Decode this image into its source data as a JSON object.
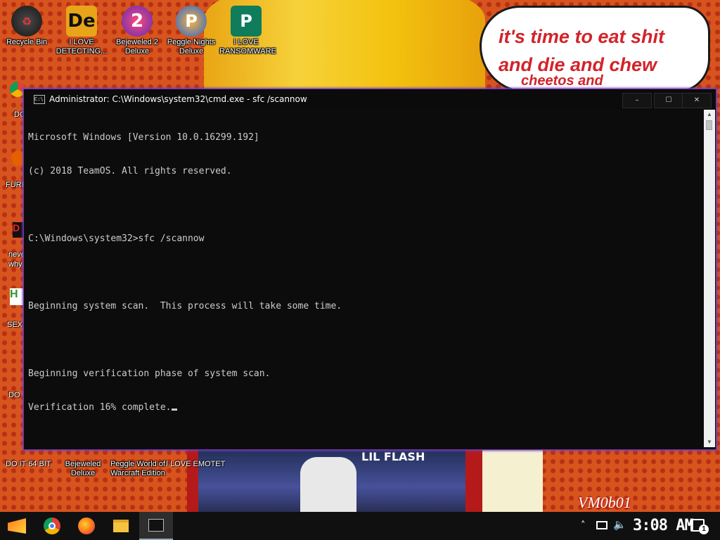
{
  "desktop": {
    "wallpaper_text": {
      "line1": "it's time to eat shit",
      "line2": "and die and chew",
      "line3": "cheetos and"
    },
    "album_text": "LIL FLASH",
    "watermark": "VM0b01",
    "top_icons": [
      {
        "label": "Recycle Bin",
        "icon": "recycle-bin-icon"
      },
      {
        "label": "I LOVE DETECTING...",
        "icon": "app-icon-de"
      },
      {
        "label": "Bejeweled 2 Deluxe",
        "icon": "bejeweled-icon"
      },
      {
        "label": "Peggle Nights Deluxe",
        "icon": "peggle-icon"
      },
      {
        "label": "I LOVE RANSOMWARE",
        "icon": "publisher-icon"
      }
    ],
    "left_partial_labels": [
      "DC",
      "FURF",
      "neve",
      "why",
      "SEX",
      "DO"
    ],
    "bottom_icons": [
      {
        "label": "DO IT 64 BIT"
      },
      {
        "label": "Bejeweled Deluxe"
      },
      {
        "label": "Peggle World of Warcraft Edition"
      },
      {
        "label": "I LOVE EMOTET"
      }
    ]
  },
  "cmd_window": {
    "title": "Administrator: C:\\Windows\\system32\\cmd.exe - sfc  /scannow",
    "buttons": {
      "minimize": "–",
      "maximize": "☐",
      "close": "✕"
    },
    "lines": [
      "Microsoft Windows [Version 10.0.16299.192]",
      "(c) 2018 TeamOS. All rights reserved.",
      "",
      "C:\\Windows\\system32>sfc /scannow",
      "",
      "Beginning system scan.  This process will take some time.",
      "",
      "Beginning verification phase of system scan.",
      "Verification 16% complete."
    ],
    "verification_progress_percent": 16
  },
  "taskbar": {
    "apps": [
      {
        "name": "Start",
        "icon": "start-icon"
      },
      {
        "name": "Google Chrome",
        "icon": "chrome-icon"
      },
      {
        "name": "Firefox",
        "icon": "firefox-icon"
      },
      {
        "name": "File Explorer",
        "icon": "folder-icon"
      },
      {
        "name": "Command Prompt",
        "icon": "cmd-icon",
        "active": true
      }
    ],
    "tray": {
      "chevron": "˄",
      "network_icon": "network-icon",
      "volume_icon": "volume-icon"
    },
    "clock": "3:08 AM",
    "notification_count": "1"
  },
  "colors": {
    "console_bg": "#0c0c0c",
    "console_text": "#cccccc",
    "window_border": "#7b3fc2",
    "speech_text": "#d2232a"
  }
}
